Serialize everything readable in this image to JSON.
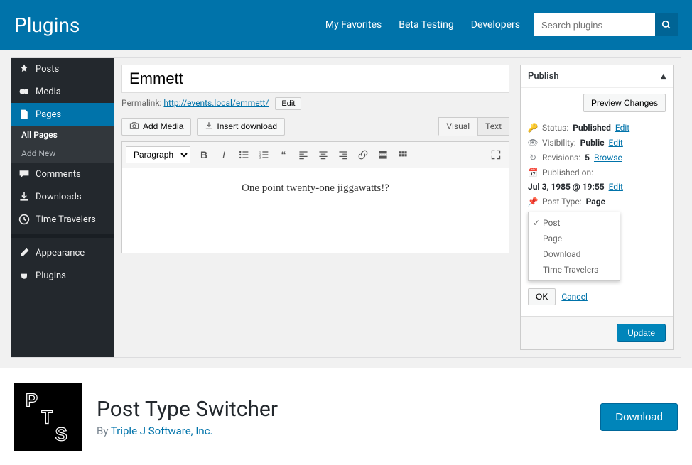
{
  "header": {
    "title": "Plugins",
    "nav": [
      "My Favorites",
      "Beta Testing",
      "Developers"
    ],
    "search_placeholder": "Search plugins"
  },
  "sidebar": {
    "items": [
      {
        "label": "Posts",
        "icon": "pin"
      },
      {
        "label": "Media",
        "icon": "media"
      },
      {
        "label": "Pages",
        "icon": "page",
        "active": true
      },
      {
        "label": "Comments",
        "icon": "comment"
      },
      {
        "label": "Downloads",
        "icon": "download"
      },
      {
        "label": "Time Travelers",
        "icon": "clock"
      },
      {
        "label": "Appearance",
        "icon": "brush"
      },
      {
        "label": "Plugins",
        "icon": "plug"
      }
    ],
    "submenu": [
      "All Pages",
      "Add New"
    ]
  },
  "editor": {
    "title": "Emmett",
    "permalink_label": "Permalink:",
    "permalink_url": "http://events.local/emmett/",
    "edit_label": "Edit",
    "add_media": "Add Media",
    "insert_download": "Insert download",
    "tabs": {
      "visual": "Visual",
      "text": "Text"
    },
    "format_label": "Paragraph",
    "content": "One point twenty-one jiggawatts!?"
  },
  "publish": {
    "title": "Publish",
    "preview": "Preview Changes",
    "status_label": "Status:",
    "status_value": "Published",
    "visibility_label": "Visibility:",
    "visibility_value": "Public",
    "revisions_label": "Revisions:",
    "revisions_value": "5",
    "browse": "Browse",
    "published_label": "Published on:",
    "published_value": "Jul 3, 1985 @ 19:55",
    "edit": "Edit",
    "posttype_label": "Post Type:",
    "posttype_value": "Page",
    "pt_options": [
      "Post",
      "Page",
      "Download",
      "Time Travelers"
    ],
    "ok": "OK",
    "cancel": "Cancel",
    "update": "Update"
  },
  "plugin": {
    "name": "Post Type Switcher",
    "by": "By ",
    "author": "Triple J Software, Inc.",
    "download": "Download"
  }
}
